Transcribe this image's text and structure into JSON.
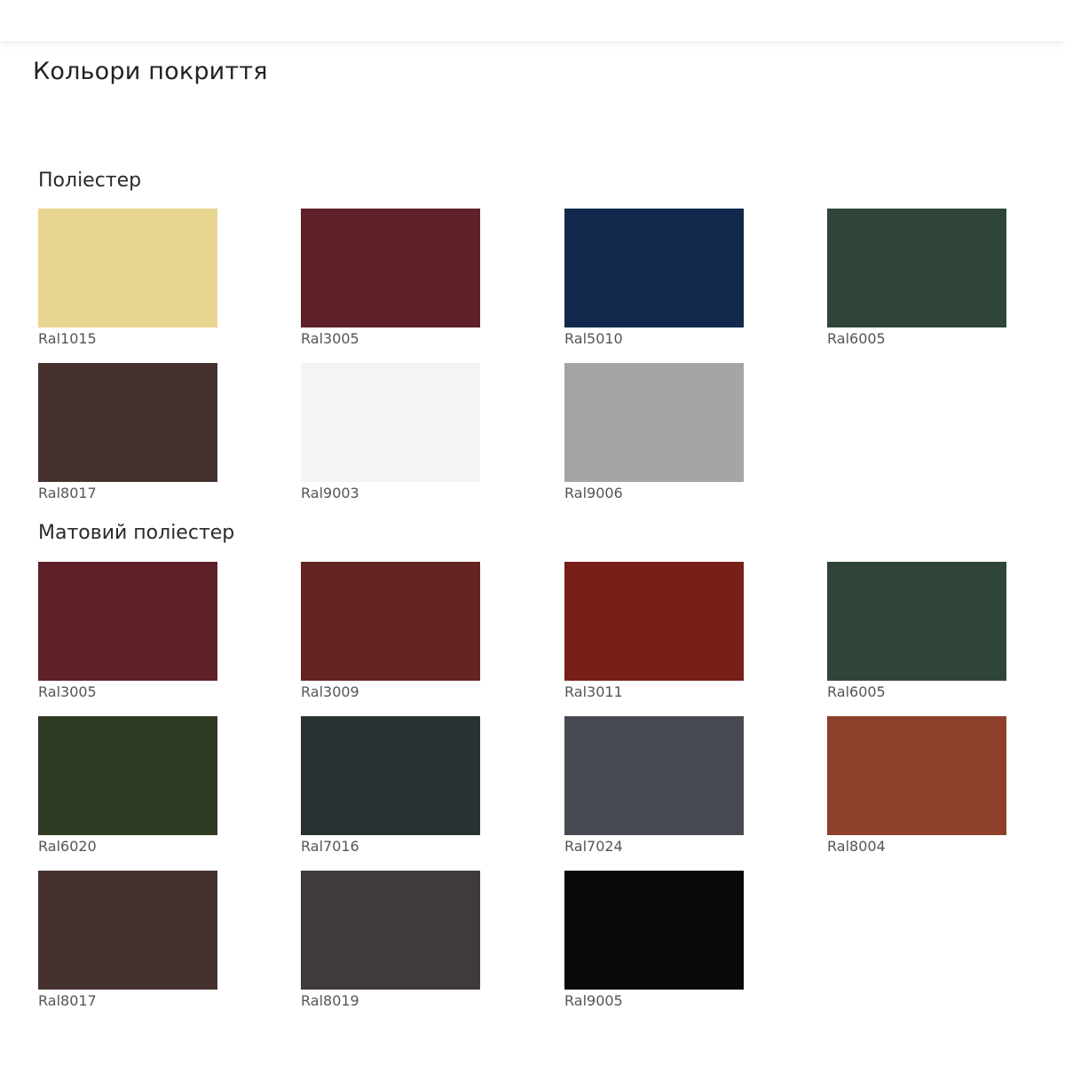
{
  "page": {
    "title": "Кольори покриття"
  },
  "sections": [
    {
      "title": "Поліестер",
      "swatches": [
        {
          "label": "Ral1015",
          "color": "#E8D690"
        },
        {
          "label": "Ral3005",
          "color": "#5E2129"
        },
        {
          "label": "Ral5010",
          "color": "#12284C"
        },
        {
          "label": "Ral6005",
          "color": "#2F4538"
        },
        {
          "label": "Ral8017",
          "color": "#45322E"
        },
        {
          "label": "Ral9003",
          "color": "#F4F4F4"
        },
        {
          "label": "Ral9006",
          "color": "#A5A5A5"
        }
      ]
    },
    {
      "title": "Матовий поліестер",
      "swatches": [
        {
          "label": "Ral3005",
          "color": "#5E2129"
        },
        {
          "label": "Ral3009",
          "color": "#642424"
        },
        {
          "label": "Ral3011",
          "color": "#781F19"
        },
        {
          "label": "Ral6005",
          "color": "#2F4538"
        },
        {
          "label": "Ral6020",
          "color": "#2E3A23"
        },
        {
          "label": "Ral7016",
          "color": "#293133"
        },
        {
          "label": "Ral7024",
          "color": "#474A51"
        },
        {
          "label": "Ral8004",
          "color": "#8E402A"
        },
        {
          "label": "Ral8017",
          "color": "#45322E"
        },
        {
          "label": "Ral8019",
          "color": "#403A3A"
        },
        {
          "label": "Ral9005",
          "color": "#0A0A0A"
        }
      ]
    }
  ]
}
